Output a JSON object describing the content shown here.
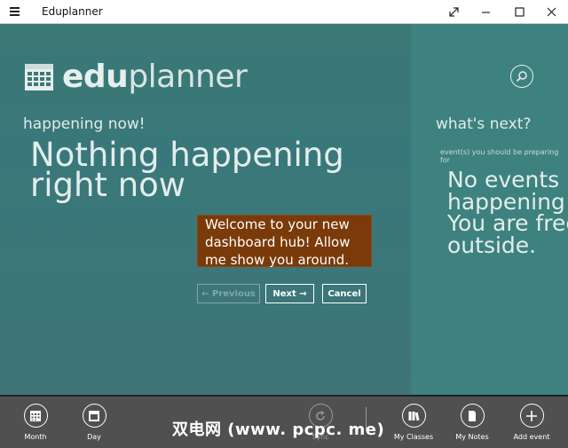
{
  "window": {
    "title": "Eduplanner"
  },
  "logo": {
    "bold": "edu",
    "thin": "planner"
  },
  "now": {
    "header": "happening now!",
    "text": "Nothing happening right now"
  },
  "next": {
    "header": "what's next?",
    "subheader": "event(s) you should be preparing for",
    "text": "No events\nhappening s\nYou are free\noutside."
  },
  "tour": {
    "message": "Welcome to your new dashboard hub! Allow me show you around.",
    "previous_label": "← Previous",
    "next_label": "Next →",
    "cancel_label": "Cancel"
  },
  "appbar": {
    "items": [
      {
        "label": "Month",
        "icon": "month-icon"
      },
      {
        "label": "Day",
        "icon": "day-icon"
      },
      {
        "label": "Sync",
        "icon": "sync-icon"
      },
      {
        "label": "My Classes",
        "icon": "classes-icon"
      },
      {
        "label": "My Notes",
        "icon": "notes-icon"
      },
      {
        "label": "Add event",
        "icon": "add-icon"
      }
    ],
    "watermark": "双电网 (www. pcpc. me)"
  },
  "colors": {
    "background": "#3b7876",
    "right_panel": "#3d827e",
    "tooltip": "#7a3a09",
    "appbar": "#505050"
  }
}
